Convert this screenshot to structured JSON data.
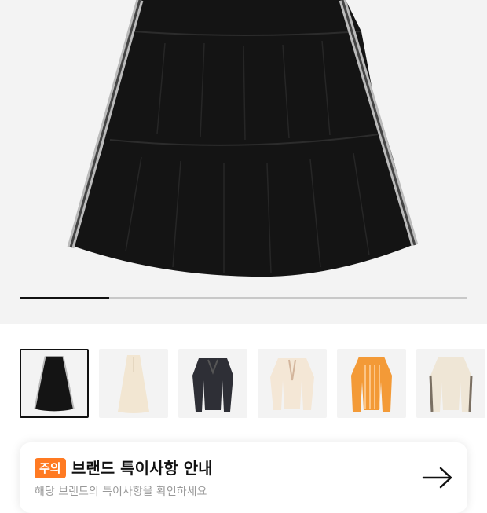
{
  "gallery": {
    "current_index": 1,
    "total": 6,
    "progress_fraction": 0.2
  },
  "thumbnails": [
    {
      "item": "black-tiered-skirt",
      "selected": true
    },
    {
      "item": "cream-long-skirt",
      "selected": false
    },
    {
      "item": "black-jacket",
      "selected": false
    },
    {
      "item": "cream-cardigan",
      "selected": false
    },
    {
      "item": "orange-striped-track-jacket",
      "selected": false
    },
    {
      "item": "cream-track-jacket",
      "selected": false
    }
  ],
  "notice": {
    "badge": "주의",
    "title": "브랜드 특이사항 안내",
    "subtitle": "해당 브랜드의 특이사항을 확인하세요",
    "badge_color": "#ff7a22"
  },
  "colors": {
    "hero_bg": "#f3f3f3",
    "accent": "#ff7a22"
  }
}
